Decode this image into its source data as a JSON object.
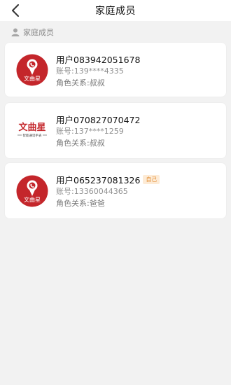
{
  "nav": {
    "title": "家庭成员"
  },
  "section": {
    "title": "家庭成员"
  },
  "members": [
    {
      "name": "用户083942051678",
      "account": "账号:139****4335",
      "role": "角色关系:叔叔",
      "badge": ""
    },
    {
      "name": "用户070827070472",
      "account": "账号:137****1259",
      "role": "角色关系:叔叔",
      "badge": ""
    },
    {
      "name": "用户065237081326",
      "account": "账号:13360044365",
      "role": "角色关系:爸爸",
      "badge": "自己"
    }
  ],
  "logo": {
    "text": "文曲星",
    "subtext": "智能通话手表"
  },
  "colors": {
    "brand_red": "#c4262b",
    "badge_text": "#e3913a",
    "badge_bg": "#fdebd6"
  }
}
